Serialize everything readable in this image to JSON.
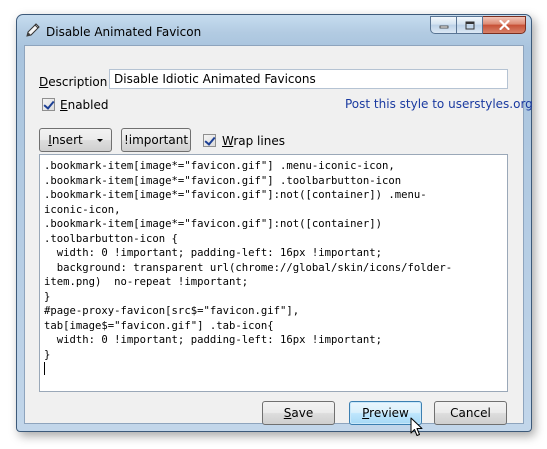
{
  "window": {
    "title": "Disable Animated Favicon"
  },
  "form": {
    "description_label_access": "D",
    "description_label_rest": "escription",
    "description_value": "Disable Idiotic Animated Favicons",
    "enabled_label_access": "E",
    "enabled_label_rest": "nabled",
    "enabled_checked": true,
    "post_link": "Post this style to userstyles.org"
  },
  "toolbar": {
    "insert_label_access": "I",
    "insert_label_rest": "nsert",
    "important_label": "!important",
    "wrap_label_access": "W",
    "wrap_label_rest": "rap lines",
    "wrap_checked": true
  },
  "code": {
    "text": ".bookmark-item[image*=\"favicon.gif\"] .menu-iconic-icon,\n.bookmark-item[image*=\"favicon.gif\"] .toolbarbutton-icon\n.bookmark-item[image*=\"favicon.gif\"]:not([container]) .menu-\niconic-icon,\n.bookmark-item[image*=\"favicon.gif\"]:not([container])\n.toolbarbutton-icon {\n  width: 0 !important; padding-left: 16px !important;\n  background: transparent url(chrome://global/skin/icons/folder-\nitem.png)  no-repeat !important;\n}\n#page-proxy-favicon[src$=\"favicon.gif\"],\ntab[image$=\"favicon.gif\"] .tab-icon{\n  width: 0 !important; padding-left: 16px !important;\n}"
  },
  "actions": {
    "save_access": "S",
    "save_rest": "ave",
    "preview_access": "P",
    "preview_rest": "review",
    "cancel_label": "Cancel"
  },
  "icons": {
    "app": "pencil-icon",
    "minimize": "minimize-icon",
    "maximize": "maximize-icon",
    "close": "close-icon",
    "cursor": "mouse-pointer-icon"
  },
  "colors": {
    "link": "#1a3aa0",
    "preview_focus_border": "#3c7fb1",
    "close_button": "#c75036"
  }
}
